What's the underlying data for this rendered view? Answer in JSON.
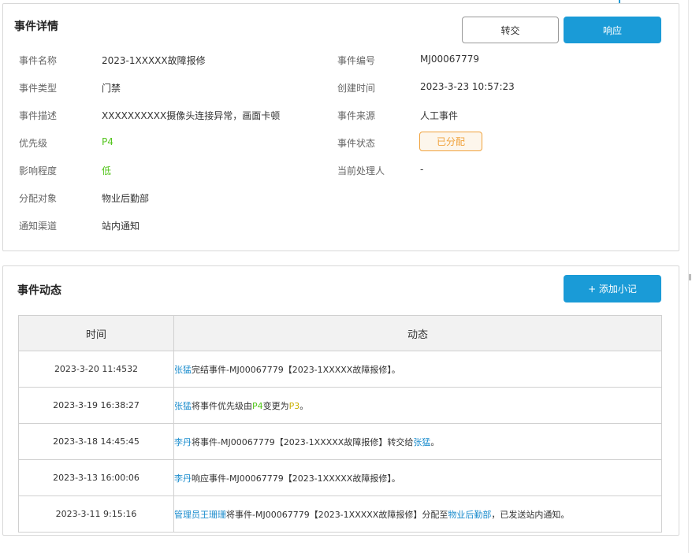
{
  "details": {
    "title": "事件详情",
    "transfer_label": "转交",
    "respond_label": "响应",
    "fields": {
      "name": {
        "label": "事件名称",
        "value": "2023-1XXXXX故障报修"
      },
      "type": {
        "label": "事件类型",
        "value": "门禁"
      },
      "desc": {
        "label": "事件描述",
        "value": "XXXXXXXXXX摄像头连接异常，画面卡顿"
      },
      "priority": {
        "label": "优先级",
        "value": "P4"
      },
      "impact": {
        "label": "影响程度",
        "value": "低"
      },
      "assignee": {
        "label": "分配对象",
        "value": "物业后勤部"
      },
      "channel": {
        "label": "通知渠道",
        "value": "站内通知"
      },
      "number": {
        "label": "事件编号",
        "value": "MJ00067779"
      },
      "created": {
        "label": "创建时间",
        "value": "2023-3-23  10:57:23"
      },
      "source": {
        "label": "事件来源",
        "value": "人工事件"
      },
      "status": {
        "label": "事件状态",
        "value": "已分配"
      },
      "handler": {
        "label": "当前处理人",
        "value": "-"
      }
    }
  },
  "events": {
    "title": "事件动态",
    "add_note_label": "+ 添加小记",
    "columns": {
      "time": "时间",
      "activity": "动态"
    },
    "rows": [
      {
        "time": "2023-3-20 11:4532",
        "parts": [
          {
            "text": "张猛",
            "kind": "link"
          },
          {
            "text": "完结事件-MJ00067779【2023-1XXXXX故障报修】。",
            "kind": "plain"
          }
        ]
      },
      {
        "time": "2023-3-19 16:38:27",
        "parts": [
          {
            "text": "张猛",
            "kind": "link"
          },
          {
            "text": "将事件优先级由",
            "kind": "plain"
          },
          {
            "text": "P4",
            "kind": "green"
          },
          {
            "text": "变更为",
            "kind": "plain"
          },
          {
            "text": "P3",
            "kind": "yellow"
          },
          {
            "text": "。",
            "kind": "plain"
          }
        ]
      },
      {
        "time": "2023-3-18  14:45:45",
        "parts": [
          {
            "text": "李丹",
            "kind": "link"
          },
          {
            "text": "将事件-MJ00067779【2023-1XXXXX故障报修】转交给",
            "kind": "plain"
          },
          {
            "text": "张猛",
            "kind": "link"
          },
          {
            "text": "。",
            "kind": "plain"
          }
        ]
      },
      {
        "time": "2023-3-13 16:00:06",
        "parts": [
          {
            "text": "李丹",
            "kind": "link"
          },
          {
            "text": "响应事件-MJ00067779【2023-1XXXXX故障报修】。",
            "kind": "plain"
          }
        ]
      },
      {
        "time": "2023-3-11  9:15:16",
        "parts": [
          {
            "text": "管理员王珊珊",
            "kind": "link"
          },
          {
            "text": "将事件-MJ00067779【2023-1XXXXX故障报修】分配至",
            "kind": "plain"
          },
          {
            "text": "物业后勤部",
            "kind": "link"
          },
          {
            "text": "，已发送站内通知。",
            "kind": "plain"
          }
        ]
      }
    ]
  }
}
